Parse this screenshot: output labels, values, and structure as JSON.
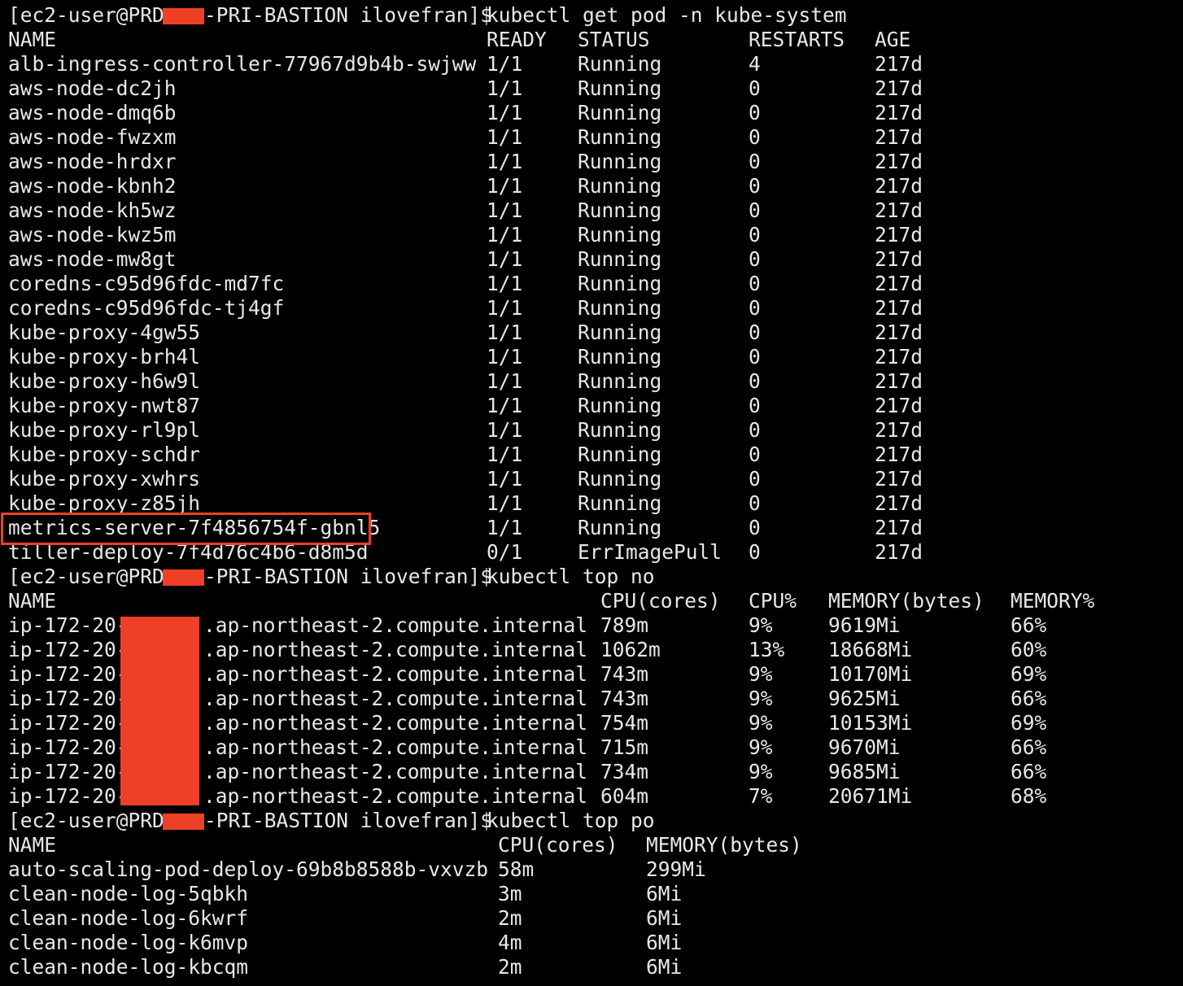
{
  "theme": {
    "background": "#000000",
    "foreground": "#e8e8e8",
    "redaction_color": "#ee4027",
    "highlight_color": "#ee4027"
  },
  "block1": {
    "prompt_user": "[ec2-user@PRD-",
    "prompt_host_rest": "-PRI-BASTION ilovefran]$",
    "command": "kubectl get pod -n kube-system",
    "headers": {
      "name": "NAME",
      "ready": "READY",
      "status": "STATUS",
      "restarts": "RESTARTS",
      "age": "AGE"
    },
    "rows": [
      {
        "name": "alb-ingress-controller-77967d9b4b-swjww",
        "ready": "1/1",
        "status": "Running",
        "restarts": "4",
        "age": "217d"
      },
      {
        "name": "aws-node-dc2jh",
        "ready": "1/1",
        "status": "Running",
        "restarts": "0",
        "age": "217d"
      },
      {
        "name": "aws-node-dmq6b",
        "ready": "1/1",
        "status": "Running",
        "restarts": "0",
        "age": "217d"
      },
      {
        "name": "aws-node-fwzxm",
        "ready": "1/1",
        "status": "Running",
        "restarts": "0",
        "age": "217d"
      },
      {
        "name": "aws-node-hrdxr",
        "ready": "1/1",
        "status": "Running",
        "restarts": "0",
        "age": "217d"
      },
      {
        "name": "aws-node-kbnh2",
        "ready": "1/1",
        "status": "Running",
        "restarts": "0",
        "age": "217d"
      },
      {
        "name": "aws-node-kh5wz",
        "ready": "1/1",
        "status": "Running",
        "restarts": "0",
        "age": "217d"
      },
      {
        "name": "aws-node-kwz5m",
        "ready": "1/1",
        "status": "Running",
        "restarts": "0",
        "age": "217d"
      },
      {
        "name": "aws-node-mw8gt",
        "ready": "1/1",
        "status": "Running",
        "restarts": "0",
        "age": "217d"
      },
      {
        "name": "coredns-c95d96fdc-md7fc",
        "ready": "1/1",
        "status": "Running",
        "restarts": "0",
        "age": "217d"
      },
      {
        "name": "coredns-c95d96fdc-tj4gf",
        "ready": "1/1",
        "status": "Running",
        "restarts": "0",
        "age": "217d"
      },
      {
        "name": "kube-proxy-4gw55",
        "ready": "1/1",
        "status": "Running",
        "restarts": "0",
        "age": "217d"
      },
      {
        "name": "kube-proxy-brh4l",
        "ready": "1/1",
        "status": "Running",
        "restarts": "0",
        "age": "217d"
      },
      {
        "name": "kube-proxy-h6w9l",
        "ready": "1/1",
        "status": "Running",
        "restarts": "0",
        "age": "217d"
      },
      {
        "name": "kube-proxy-nwt87",
        "ready": "1/1",
        "status": "Running",
        "restarts": "0",
        "age": "217d"
      },
      {
        "name": "kube-proxy-rl9pl",
        "ready": "1/1",
        "status": "Running",
        "restarts": "0",
        "age": "217d"
      },
      {
        "name": "kube-proxy-schdr",
        "ready": "1/1",
        "status": "Running",
        "restarts": "0",
        "age": "217d"
      },
      {
        "name": "kube-proxy-xwhrs",
        "ready": "1/1",
        "status": "Running",
        "restarts": "0",
        "age": "217d"
      },
      {
        "name": "kube-proxy-z85jh",
        "ready": "1/1",
        "status": "Running",
        "restarts": "0",
        "age": "217d"
      },
      {
        "name": "metrics-server-7f4856754f-gbnl5",
        "ready": "1/1",
        "status": "Running",
        "restarts": "0",
        "age": "217d",
        "highlighted": true
      },
      {
        "name": "tiller-deploy-7f4d76c4b6-d8m5d",
        "ready": "0/1",
        "status": "ErrImagePull",
        "restarts": "0",
        "age": "217d"
      }
    ]
  },
  "block2": {
    "prompt_user": "[ec2-user@PRD-",
    "prompt_host_rest": "-PRI-BASTION ilovefran]$",
    "command": "kubectl top no",
    "headers": {
      "name": "NAME",
      "cpu": "CPU(cores)",
      "cpu_pct": "CPU%",
      "mem": "MEMORY(bytes)",
      "mem_pct": "MEMORY%"
    },
    "name_prefix": "ip-172-20-",
    "name_suffix": ".ap-northeast-2.compute.internal",
    "rows": [
      {
        "cpu": "789m",
        "cpu_pct": "9%",
        "mem": "9619Mi",
        "mem_pct": "66%"
      },
      {
        "cpu": "1062m",
        "cpu_pct": "13%",
        "mem": "18668Mi",
        "mem_pct": "60%"
      },
      {
        "cpu": "743m",
        "cpu_pct": "9%",
        "mem": "10170Mi",
        "mem_pct": "69%"
      },
      {
        "cpu": "743m",
        "cpu_pct": "9%",
        "mem": "9625Mi",
        "mem_pct": "66%"
      },
      {
        "cpu": "754m",
        "cpu_pct": "9%",
        "mem": "10153Mi",
        "mem_pct": "69%"
      },
      {
        "cpu": "715m",
        "cpu_pct": "9%",
        "mem": "9670Mi",
        "mem_pct": "66%"
      },
      {
        "cpu": "734m",
        "cpu_pct": "9%",
        "mem": "9685Mi",
        "mem_pct": "66%"
      },
      {
        "cpu": "604m",
        "cpu_pct": "7%",
        "mem": "20671Mi",
        "mem_pct": "68%"
      }
    ]
  },
  "block3": {
    "prompt_user": "[ec2-user@PRD-",
    "prompt_host_rest": "-PRI-BASTION ilovefran]$",
    "command": "kubectl top po",
    "headers": {
      "name": "NAME",
      "cpu": "CPU(cores)",
      "mem": "MEMORY(bytes)"
    },
    "rows": [
      {
        "name": "auto-scaling-pod-deploy-69b8b8588b-vxvzb",
        "cpu": "58m",
        "mem": "299Mi"
      },
      {
        "name": "clean-node-log-5qbkh",
        "cpu": "3m",
        "mem": "6Mi"
      },
      {
        "name": "clean-node-log-6kwrf",
        "cpu": "2m",
        "mem": "6Mi"
      },
      {
        "name": "clean-node-log-k6mvp",
        "cpu": "4m",
        "mem": "6Mi"
      },
      {
        "name": "clean-node-log-kbcqm",
        "cpu": "2m",
        "mem": "6Mi"
      }
    ]
  }
}
